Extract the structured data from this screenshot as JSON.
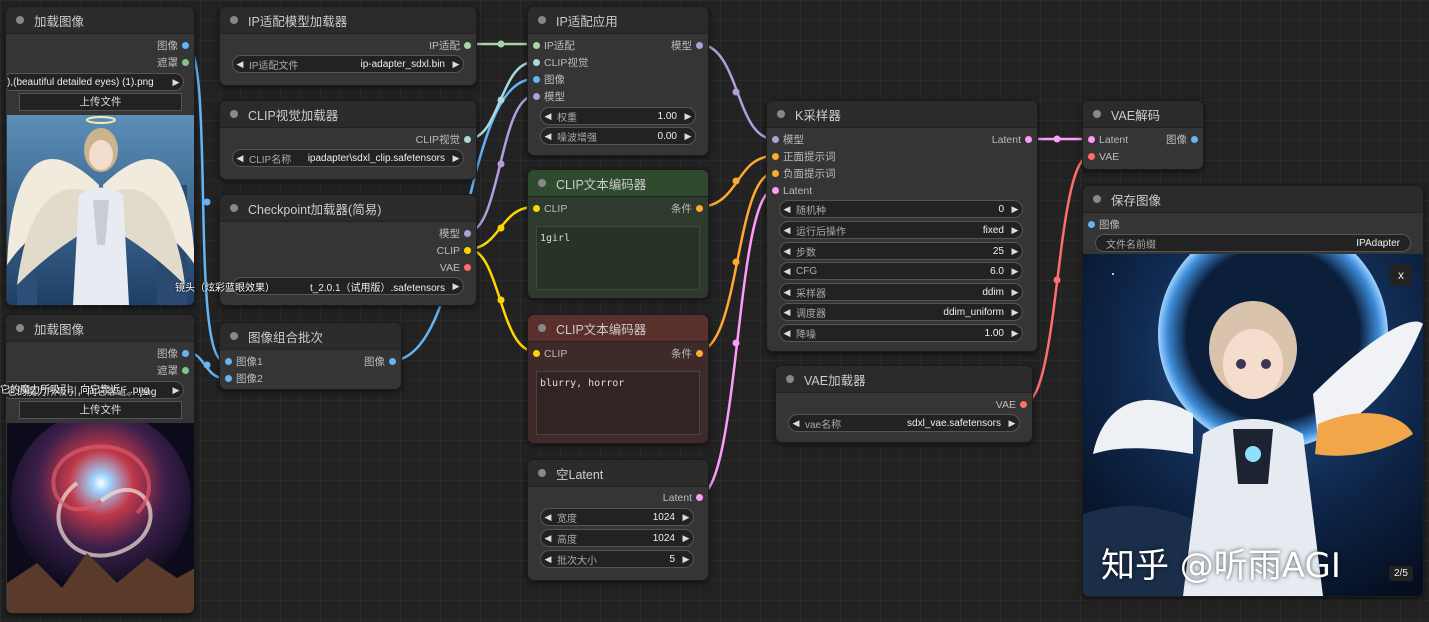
{
  "colors": {
    "image": "#64b5f6",
    "mask": "#81c784",
    "model": "#b39ddb",
    "clip": "#ffd500",
    "vae": "#ff6e6e",
    "latent": "#ff9cf9",
    "conditioning": "#ffa931",
    "clip_vision": "#a8dadc",
    "ipadapter": "#a5d6a7"
  },
  "load_image_1": {
    "title": "加载图像",
    "out_image": "图像",
    "out_mask": "遮罩",
    "file": "),(beautiful detailed eyes) (1).png",
    "upload": "上传文件"
  },
  "load_image_2": {
    "title": "加载图像",
    "out_image": "图像",
    "out_mask": "遮罩",
    "file": "它的魔力所吸引，向它靠近。.png",
    "upload": "上传文件"
  },
  "ipadapter_loader": {
    "title": "IP适配模型加载器",
    "out": "IP适配",
    "w_label": "IP适配文件",
    "w_value": "ip-adapter_sdxl.bin"
  },
  "clip_vision_loader": {
    "title": "CLIP视觉加载器",
    "out": "CLIP视觉",
    "w_label": "CLIP名称",
    "w_value": "ipadapter\\sdxl_clip.safetensors"
  },
  "checkpoint_loader": {
    "title": "Checkpoint加载器(简易)",
    "out_model": "模型",
    "out_clip": "CLIP",
    "out_vae": "VAE",
    "w_value": "t_2.0.1（试用版）.safetensors",
    "overlay": "镜头（炫彩蓝眼效果）"
  },
  "image_batch": {
    "title": "图像组合批次",
    "in1": "图像1",
    "in2": "图像2",
    "out": "图像"
  },
  "ipadapter_apply": {
    "title": "IP适配应用",
    "in_ipadapter": "IP适配",
    "in_clipvision": "CLIP视觉",
    "in_image": "图像",
    "in_model": "模型",
    "out_model": "模型",
    "w_weight_label": "权重",
    "w_weight_value": "1.00",
    "w_noise_label": "噪波增强",
    "w_noise_value": "0.00"
  },
  "clip_text_pos": {
    "title": "CLIP文本编码器",
    "in_clip": "CLIP",
    "out": "条件",
    "text": "1girl"
  },
  "clip_text_neg": {
    "title": "CLIP文本编码器",
    "in_clip": "CLIP",
    "out": "条件",
    "text": "blurry, horror"
  },
  "empty_latent": {
    "title": "空Latent",
    "out": "Latent",
    "widgets": [
      {
        "label": "宽度",
        "value": "1024"
      },
      {
        "label": "高度",
        "value": "1024"
      },
      {
        "label": "批次大小",
        "value": "5"
      }
    ]
  },
  "ksampler": {
    "title": "K采样器",
    "in_model": "模型",
    "in_pos": "正面提示词",
    "in_neg": "负面提示词",
    "in_latent": "Latent",
    "out": "Latent",
    "widgets": [
      {
        "label": "随机种",
        "value": "0"
      },
      {
        "label": "运行后操作",
        "value": "fixed"
      },
      {
        "label": "步数",
        "value": "25"
      },
      {
        "label": "CFG",
        "value": "6.0"
      },
      {
        "label": "采样器",
        "value": "ddim"
      },
      {
        "label": "调度器",
        "value": "ddim_uniform"
      },
      {
        "label": "降噪",
        "value": "1.00"
      }
    ]
  },
  "vae_loader": {
    "title": "VAE加载器",
    "out": "VAE",
    "w_label": "vae名称",
    "w_value": "sdxl_vae.safetensors"
  },
  "vae_decode": {
    "title": "VAE解码",
    "in_latent": "Latent",
    "in_vae": "VAE",
    "out": "图像"
  },
  "save_image": {
    "title": "保存图像",
    "in_image": "图像",
    "w_label": "文件名前缀",
    "w_value": "IPAdapter",
    "close": "x",
    "counter": "2/5",
    "watermark": "知乎 @听雨AGI"
  }
}
